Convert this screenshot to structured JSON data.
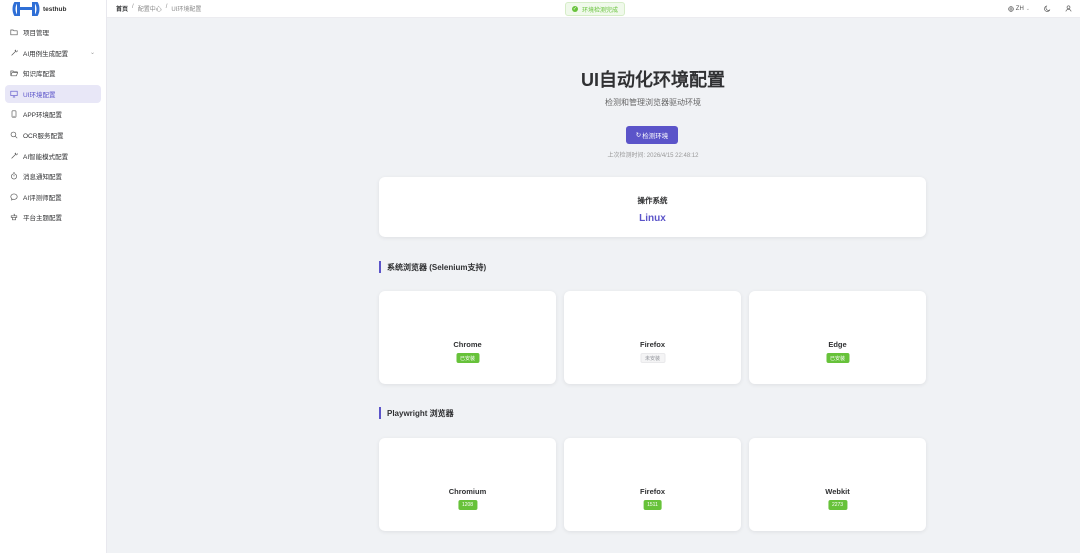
{
  "app": {
    "logo_text": "testhub"
  },
  "sidebar": {
    "items": [
      {
        "label": "项目管理",
        "icon": "folder-icon"
      },
      {
        "label": "AI用例生成配置",
        "icon": "magic-wand-icon",
        "has_children": true
      },
      {
        "label": "知识库配置",
        "icon": "folder-open-icon"
      },
      {
        "label": "UI环境配置",
        "icon": "monitor-icon",
        "active": true
      },
      {
        "label": "APP环境配置",
        "icon": "phone-icon"
      },
      {
        "label": "OCR服务配置",
        "icon": "search-icon"
      },
      {
        "label": "AI智能模式配置",
        "icon": "magic-wand-icon"
      },
      {
        "label": "消息通知配置",
        "icon": "timer-icon"
      },
      {
        "label": "AI评测师配置",
        "icon": "chat-icon"
      },
      {
        "label": "平台主题配置",
        "icon": "brush-icon"
      }
    ]
  },
  "header": {
    "breadcrumb": [
      "首页",
      "配置中心",
      "UI环境配置"
    ],
    "separator": "/",
    "toast": "环境检测完成",
    "lang": "ZH"
  },
  "main": {
    "title": "UI自动化环境配置",
    "subtitle": "检测和管理浏览器驱动环境",
    "detect_button": "检测环境",
    "last_check": "上次检测时间: 2026/4/15 22:48:12",
    "os": {
      "label": "操作系统",
      "value": "Linux"
    },
    "system_section": {
      "title": "系统浏览器 (Selenium支持)",
      "browsers": [
        {
          "name": "Chrome",
          "status": "已安装",
          "installed": true
        },
        {
          "name": "Firefox",
          "status": "未安装",
          "installed": false
        },
        {
          "name": "Edge",
          "status": "已安装",
          "installed": true
        }
      ]
    },
    "playwright_section": {
      "title": "Playwright 浏览器",
      "browsers": [
        {
          "name": "Chromium",
          "status": "1208"
        },
        {
          "name": "Firefox",
          "status": "1511"
        },
        {
          "name": "Webkit",
          "status": "2273"
        }
      ]
    }
  },
  "colors": {
    "accent": "#5b54c9",
    "success": "#67c23a"
  }
}
